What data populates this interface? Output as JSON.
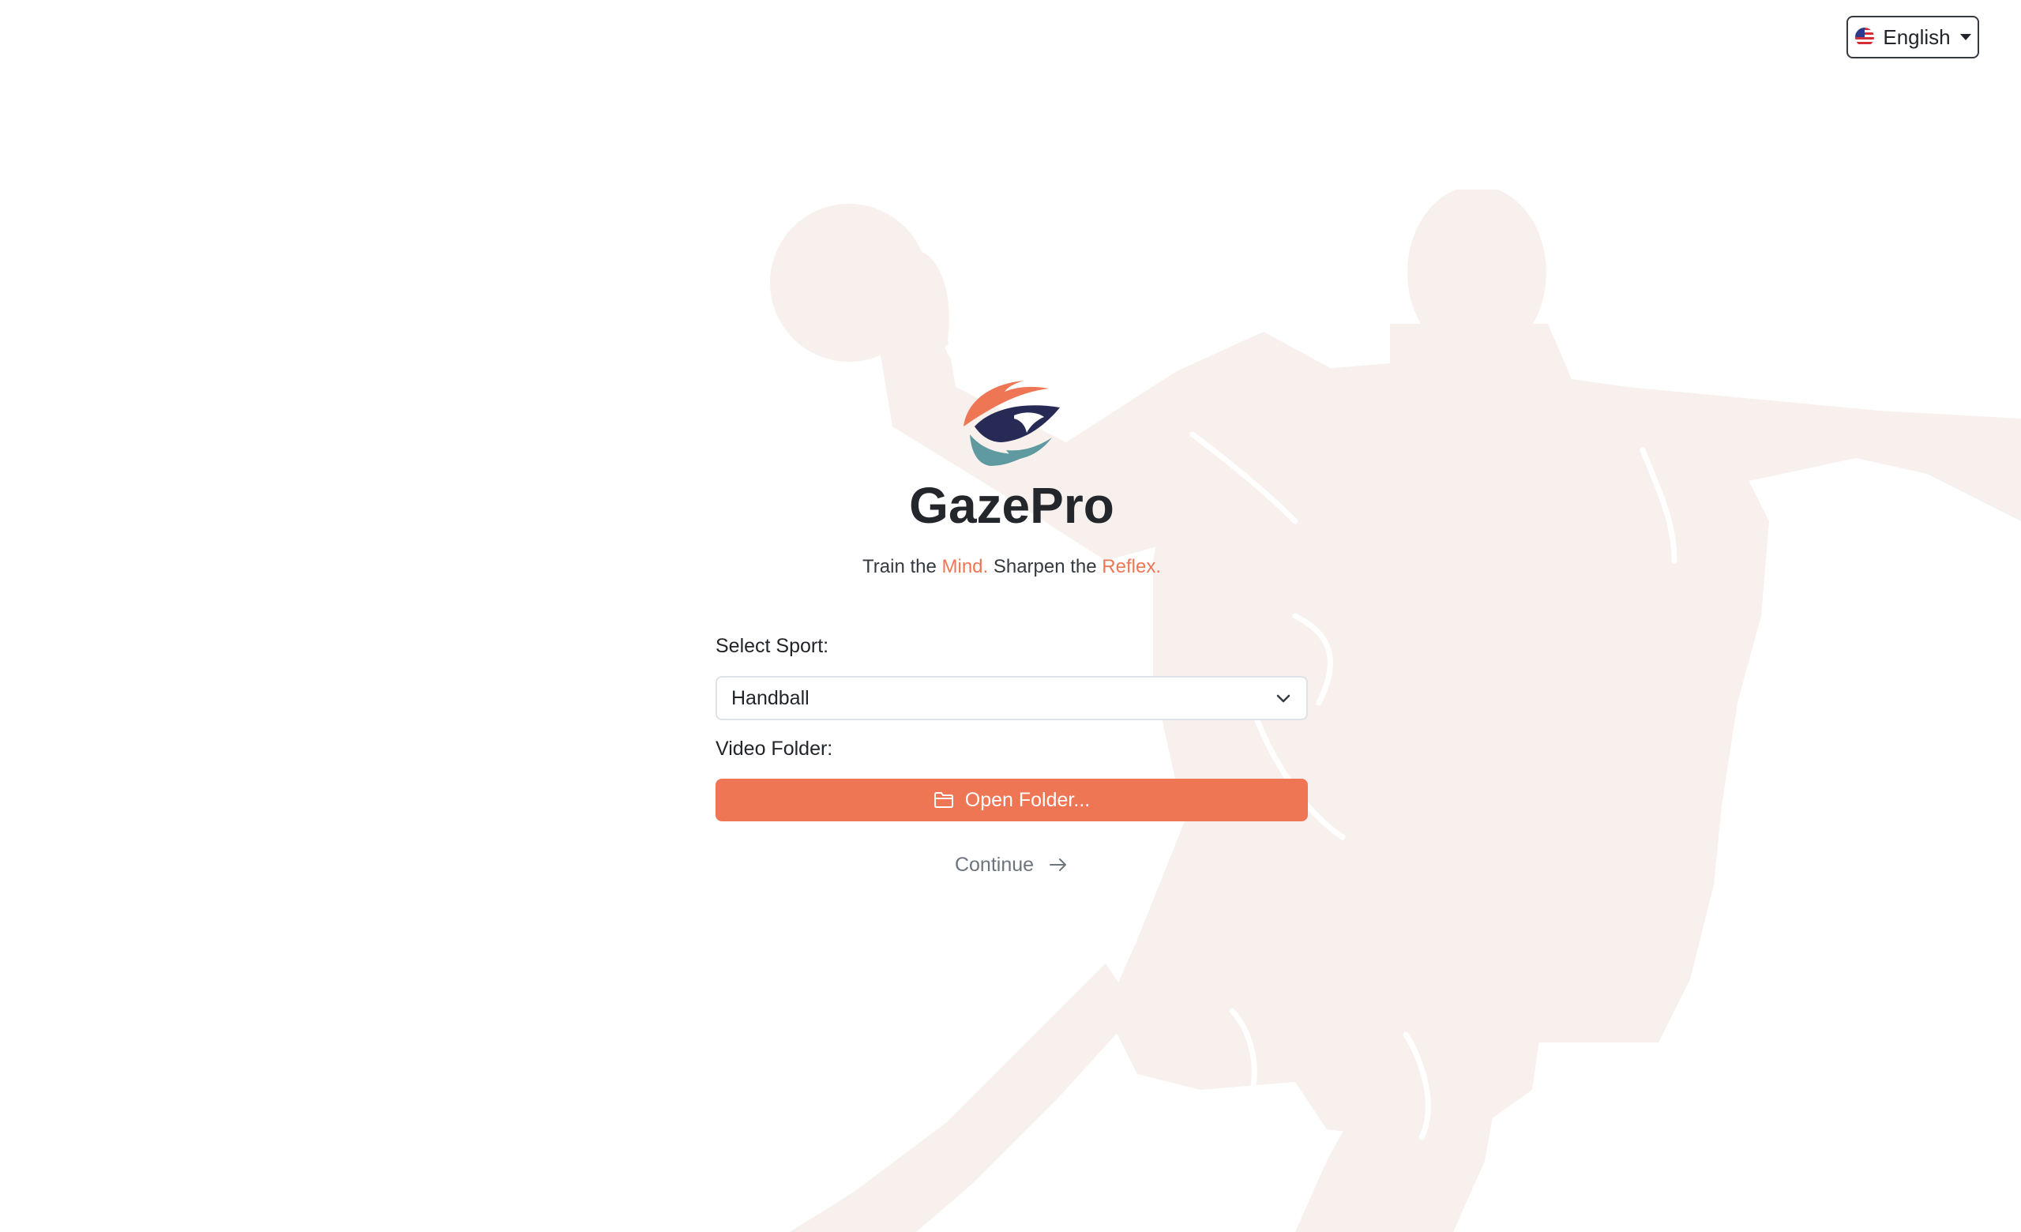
{
  "language": {
    "label": "English",
    "flag_icon": "us-flag-icon"
  },
  "brand": {
    "title": "GazePro",
    "tagline_part1": "Train the ",
    "tagline_accent1": "Mind.",
    "tagline_part2": " Sharpen the ",
    "tagline_accent2": "Reflex."
  },
  "form": {
    "sport_label": "Select Sport:",
    "sport_value": "Handball",
    "folder_label": "Video Folder:",
    "open_folder_label": "Open Folder...",
    "continue_label": "Continue"
  },
  "colors": {
    "accent": "#ee7654",
    "logo_navy": "#262a55",
    "logo_teal": "#5e9aa0",
    "silhouette": "#f8f0ec"
  }
}
